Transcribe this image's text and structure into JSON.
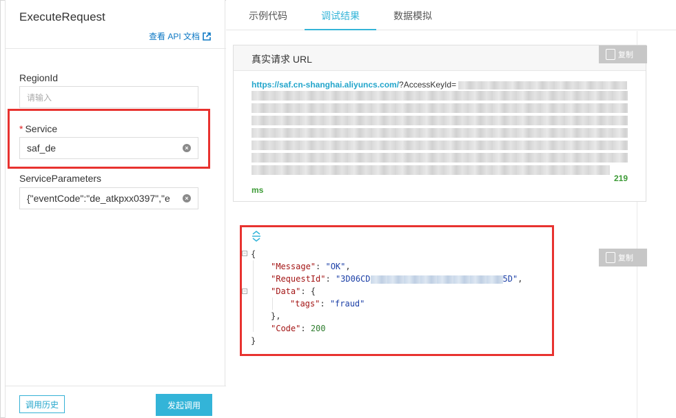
{
  "left": {
    "title": "ExecuteRequest",
    "doc_link": "查看 API 文档",
    "fields": [
      {
        "label": "RegionId",
        "required": false,
        "placeholder": "请输入",
        "value": ""
      },
      {
        "label": "Service",
        "required": true,
        "placeholder": "",
        "value": "saf_de"
      },
      {
        "label": "ServiceParameters",
        "required": false,
        "placeholder": "",
        "value": "{\"eventCode\":\"de_atkpxx0397\",\"e"
      }
    ],
    "required_mark": "*",
    "history_button": "调用历史",
    "invoke_button": "发起调用"
  },
  "tabs": [
    {
      "label": "示例代码",
      "active": false
    },
    {
      "label": "调试结果",
      "active": true
    },
    {
      "label": "数据模拟",
      "active": false
    }
  ],
  "url_box": {
    "title": "真实请求 URL",
    "copy_label": "复制",
    "url_link": "https://saf.cn-shanghai.aliyuncs.com/",
    "url_rest": "?AccessKeyId=",
    "time_value": "219",
    "time_unit": "ms"
  },
  "result": {
    "copy_label": "复制",
    "lines": {
      "open": "{",
      "message_key": "\"Message\"",
      "message_val": "\"OK\"",
      "requestid_key": "\"RequestId\"",
      "requestid_prefix": "\"3D06CD",
      "requestid_suffix": "5D\"",
      "data_key": "\"Data\"",
      "tags_key": "\"tags\"",
      "tags_val": "\"fraud\"",
      "data_close": "},",
      "code_key": "\"Code\"",
      "code_val": "200",
      "close": "}"
    }
  },
  "colors": {
    "accent": "#33b4d8",
    "highlight": "#e8322f",
    "link": "#0d78c4",
    "json_key": "#a31515",
    "json_string": "#1a3ea6",
    "json_number": "#2f7d2f"
  }
}
